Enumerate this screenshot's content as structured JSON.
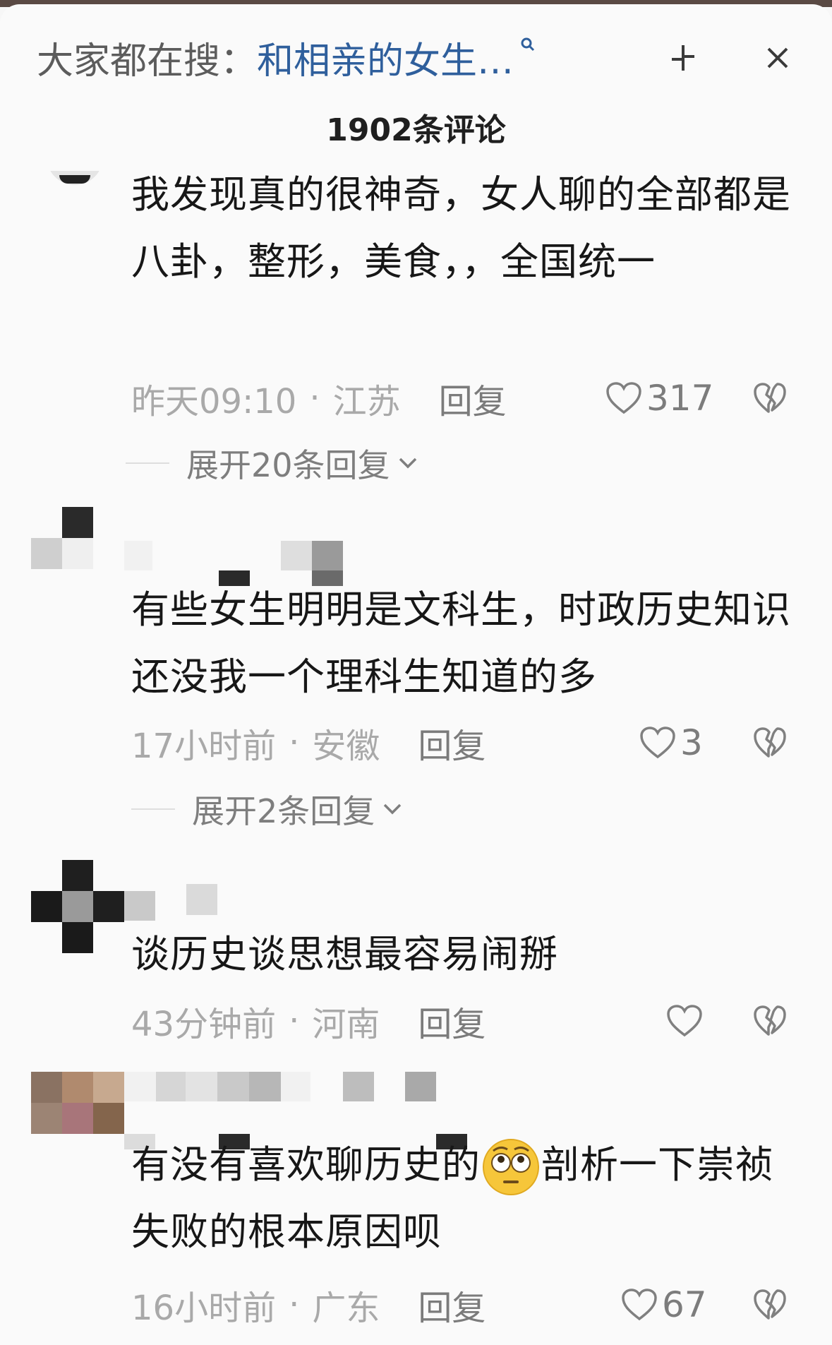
{
  "header": {
    "search_prefix": "大家都在搜：",
    "search_query": "和相亲的女生…",
    "comment_count": "1902条评论",
    "icons": [
      "search-icon",
      "collapse-icon",
      "close-icon"
    ]
  },
  "comments": [
    {
      "text": "我发现真的很神奇，女人聊的全部都是八卦，整形，美食，，全国统一",
      "time": "昨天09:10",
      "location": "江苏",
      "reply_label": "回复",
      "likes": "317",
      "expand_label": "展开20条回复"
    },
    {
      "text": "有些女生明明是文科生，时政历史知识还没我一个理科生知道的多",
      "time": "17小时前",
      "location": "安徽",
      "reply_label": "回复",
      "likes": "3",
      "expand_label": "展开2条回复"
    },
    {
      "text": "谈历史谈思想最容易闹掰",
      "time": "43分钟前",
      "location": "河南",
      "reply_label": "回复",
      "likes": ""
    },
    {
      "text_before_emoji": "有没有喜欢聊历史的",
      "emoji": "flushed-face-emoji",
      "text_after_emoji": "剖析一下崇祯失败的根本原因呗",
      "time": "16小时前",
      "location": "广东",
      "reply_label": "回复",
      "likes": "67"
    }
  ],
  "colors": {
    "search_query": "#2f5f9c",
    "meta_text": "#a9a9a9",
    "reply_text": "#7b7b7b"
  }
}
